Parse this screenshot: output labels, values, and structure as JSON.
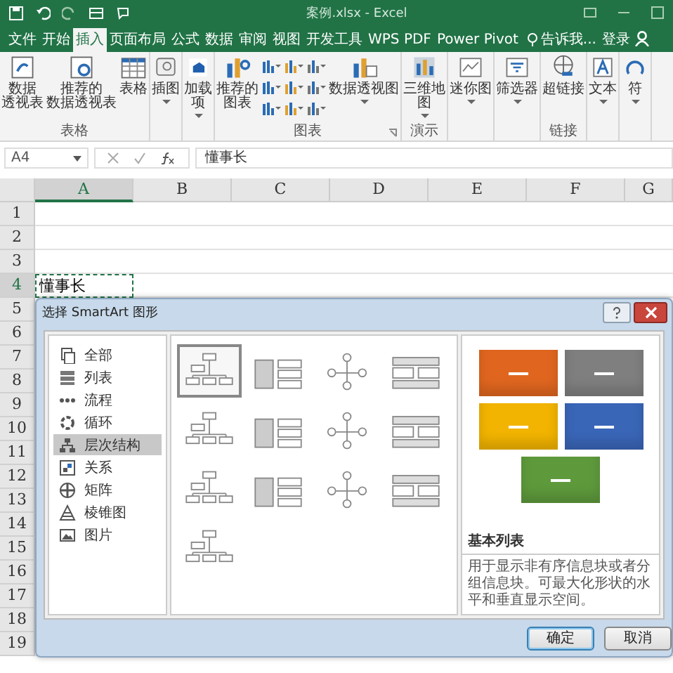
{
  "window": {
    "title": "案例.xlsx - Excel"
  },
  "menu_tabs": [
    {
      "label": "文件",
      "selected": false
    },
    {
      "label": "开始",
      "selected": false
    },
    {
      "label": "插入",
      "selected": true
    },
    {
      "label": "页面布局",
      "selected": false
    },
    {
      "label": "公式",
      "selected": false
    },
    {
      "label": "数据",
      "selected": false
    },
    {
      "label": "审阅",
      "selected": false
    },
    {
      "label": "视图",
      "selected": false
    },
    {
      "label": "开发工具",
      "selected": false
    },
    {
      "label": "WPS PDF",
      "selected": false
    },
    {
      "label": "Power Pivot",
      "selected": false
    }
  ],
  "tell_me": "告诉我...",
  "sign_in": "登录",
  "ribbon_groups": [
    {
      "label": "表格",
      "items": [
        {
          "kind": "large",
          "lines": [
            "数据",
            "透视表"
          ],
          "dropdown": false
        },
        {
          "kind": "large",
          "lines": [
            "推荐的",
            "数据透视表"
          ],
          "dropdown": false
        },
        {
          "kind": "large",
          "lines": [
            "表格"
          ],
          "dropdown": false
        }
      ]
    },
    {
      "items": [
        {
          "kind": "large",
          "lines": [
            "插图"
          ],
          "dropdown": true
        }
      ]
    },
    {
      "items": [
        {
          "kind": "large",
          "lines": [
            "加载",
            "项"
          ],
          "dropdown": true
        }
      ]
    },
    {
      "label": "图表",
      "launcher": true,
      "items": [
        {
          "kind": "large",
          "lines": [
            "推荐的",
            "图表"
          ],
          "dropdown": false
        },
        {
          "kind": "chart-grid"
        },
        {
          "kind": "large",
          "lines": [
            "数据透视图"
          ],
          "dropdown": true
        }
      ]
    },
    {
      "label": "演示",
      "items": [
        {
          "kind": "large",
          "lines": [
            "三维地",
            "图"
          ],
          "dropdown": true
        }
      ]
    },
    {
      "items": [
        {
          "kind": "large",
          "lines": [
            "迷你图"
          ],
          "dropdown": true
        }
      ]
    },
    {
      "items": [
        {
          "kind": "large",
          "lines": [
            "筛选器"
          ],
          "dropdown": true
        }
      ]
    },
    {
      "label": "链接",
      "items": [
        {
          "kind": "large",
          "lines": [
            "超链接"
          ],
          "dropdown": false
        }
      ]
    },
    {
      "items": [
        {
          "kind": "large",
          "lines": [
            "文本"
          ],
          "dropdown": true
        }
      ]
    },
    {
      "items": [
        {
          "kind": "large",
          "lines": [
            "符"
          ],
          "dropdown": true
        }
      ]
    }
  ],
  "formula_bar": {
    "name_box": "A4",
    "value": "懂事长"
  },
  "sheet": {
    "columns": [
      {
        "label": "A",
        "selected": true
      },
      {
        "label": "B",
        "selected": false
      },
      {
        "label": "C",
        "selected": false
      },
      {
        "label": "D",
        "selected": false
      },
      {
        "label": "E",
        "selected": false
      },
      {
        "label": "F",
        "selected": false
      },
      {
        "label": "G",
        "selected": false
      }
    ],
    "rows": [
      {
        "label": "1",
        "selected": false
      },
      {
        "label": "2",
        "selected": false
      },
      {
        "label": "3",
        "selected": false
      },
      {
        "label": "4",
        "selected": true,
        "cell_a": "懂事长"
      },
      {
        "label": "5",
        "selected": false
      },
      {
        "label": "6",
        "selected": false
      },
      {
        "label": "7",
        "selected": false
      },
      {
        "label": "8",
        "selected": false
      },
      {
        "label": "9",
        "selected": false
      },
      {
        "label": "10",
        "selected": false
      },
      {
        "label": "11",
        "selected": false
      },
      {
        "label": "12",
        "selected": false
      },
      {
        "label": "13",
        "selected": false
      },
      {
        "label": "14",
        "selected": false
      },
      {
        "label": "15",
        "selected": false
      },
      {
        "label": "16",
        "selected": false
      },
      {
        "label": "17",
        "selected": false
      },
      {
        "label": "18",
        "selected": false
      },
      {
        "label": "19",
        "selected": false
      }
    ]
  },
  "dialog": {
    "title": "选择 SmartArt 图形",
    "categories": [
      {
        "label": "全部",
        "selected": false
      },
      {
        "label": "列表",
        "selected": false
      },
      {
        "label": "流程",
        "selected": false
      },
      {
        "label": "循环",
        "selected": false
      },
      {
        "label": "层次结构",
        "selected": true
      },
      {
        "label": "关系",
        "selected": false
      },
      {
        "label": "矩阵",
        "selected": false
      },
      {
        "label": "棱锥图",
        "selected": false
      },
      {
        "label": "图片",
        "selected": false
      }
    ],
    "layouts": [
      {
        "selected": true
      },
      {
        "selected": false
      },
      {
        "selected": false
      },
      {
        "selected": false
      },
      {
        "selected": false
      },
      {
        "selected": false
      },
      {
        "selected": false
      },
      {
        "selected": false
      },
      {
        "selected": false
      },
      {
        "selected": false
      },
      {
        "selected": false
      },
      {
        "selected": false
      },
      {
        "selected": false
      }
    ],
    "preview_shapes": [
      {
        "color": "#e0661f"
      },
      {
        "color": "#7f7f7f"
      },
      {
        "color": "#f2b400"
      },
      {
        "color": "#3a66b8"
      },
      {
        "color": "#5e9a3c"
      }
    ],
    "preview_title": "基本列表",
    "description": "用于显示非有序信息块或者分组信息块。可最大化形状的水平和垂直显示空间。",
    "buttons": [
      "确定",
      "取消"
    ]
  }
}
